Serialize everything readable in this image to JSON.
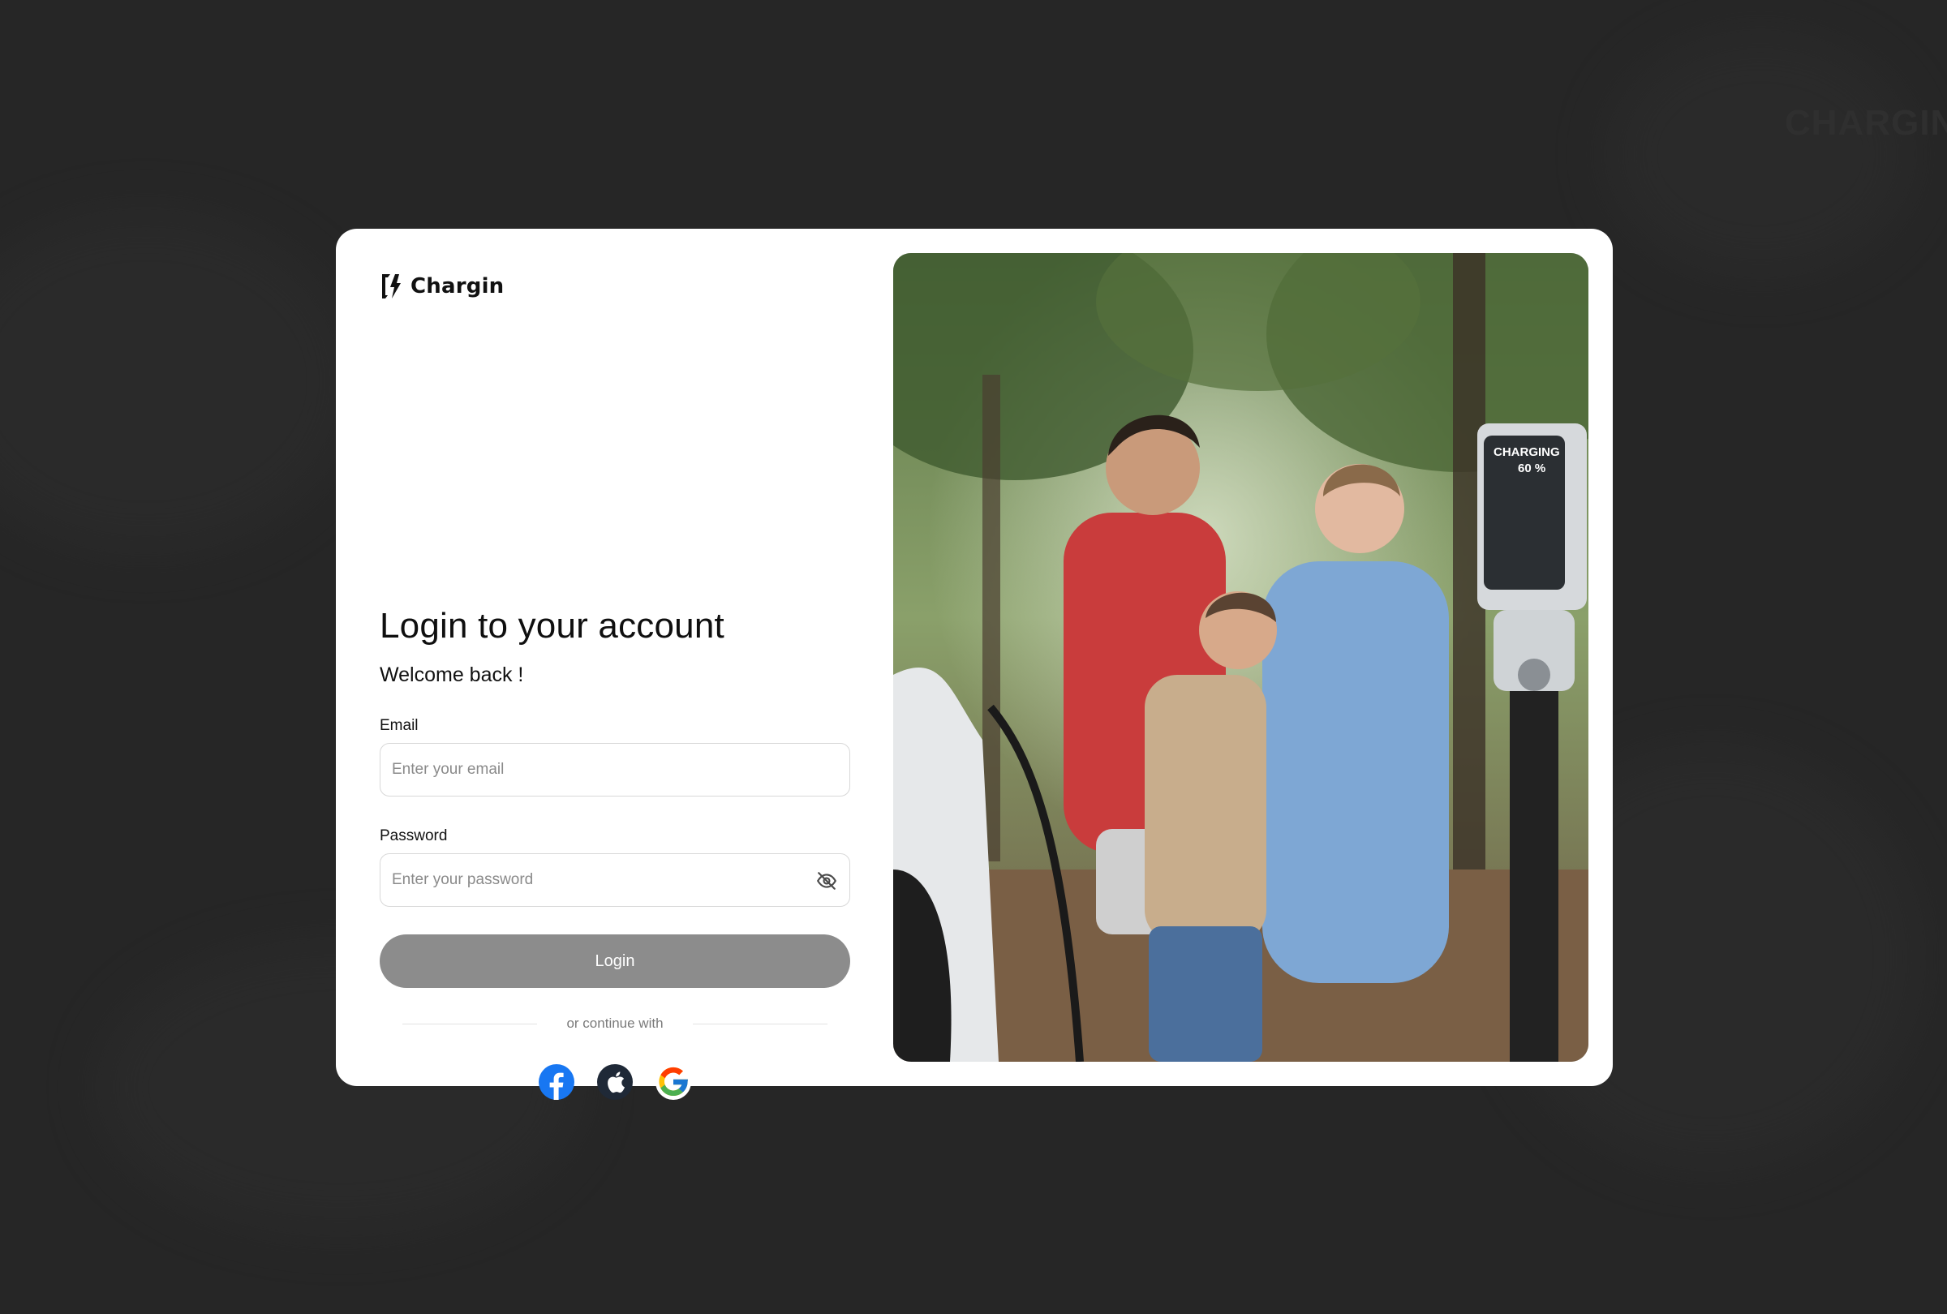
{
  "brand": {
    "name": "Chargin"
  },
  "login": {
    "title": "Login to your account",
    "subtitle": "Welcome back !",
    "email_label": "Email",
    "email_placeholder": "Enter your email",
    "email_value": "",
    "password_label": "Password",
    "password_placeholder": "Enter your password",
    "password_value": "",
    "submit_label": "Login",
    "divider_text": "or continue with"
  },
  "social": [
    {
      "name": "facebook",
      "icon": "facebook-icon",
      "color": "#1877F2"
    },
    {
      "name": "apple",
      "icon": "apple-icon",
      "color": "#1f2937"
    },
    {
      "name": "google",
      "icon": "google-icon",
      "color": "#4285F4"
    }
  ],
  "hero": {
    "charger_status": "CHARGING",
    "charger_percent": "60 %"
  },
  "background": {
    "watermark": "CHARGIN"
  },
  "colors": {
    "page_bg": "#262626",
    "card_bg": "#ffffff",
    "button_disabled": "#8c8c8c"
  }
}
